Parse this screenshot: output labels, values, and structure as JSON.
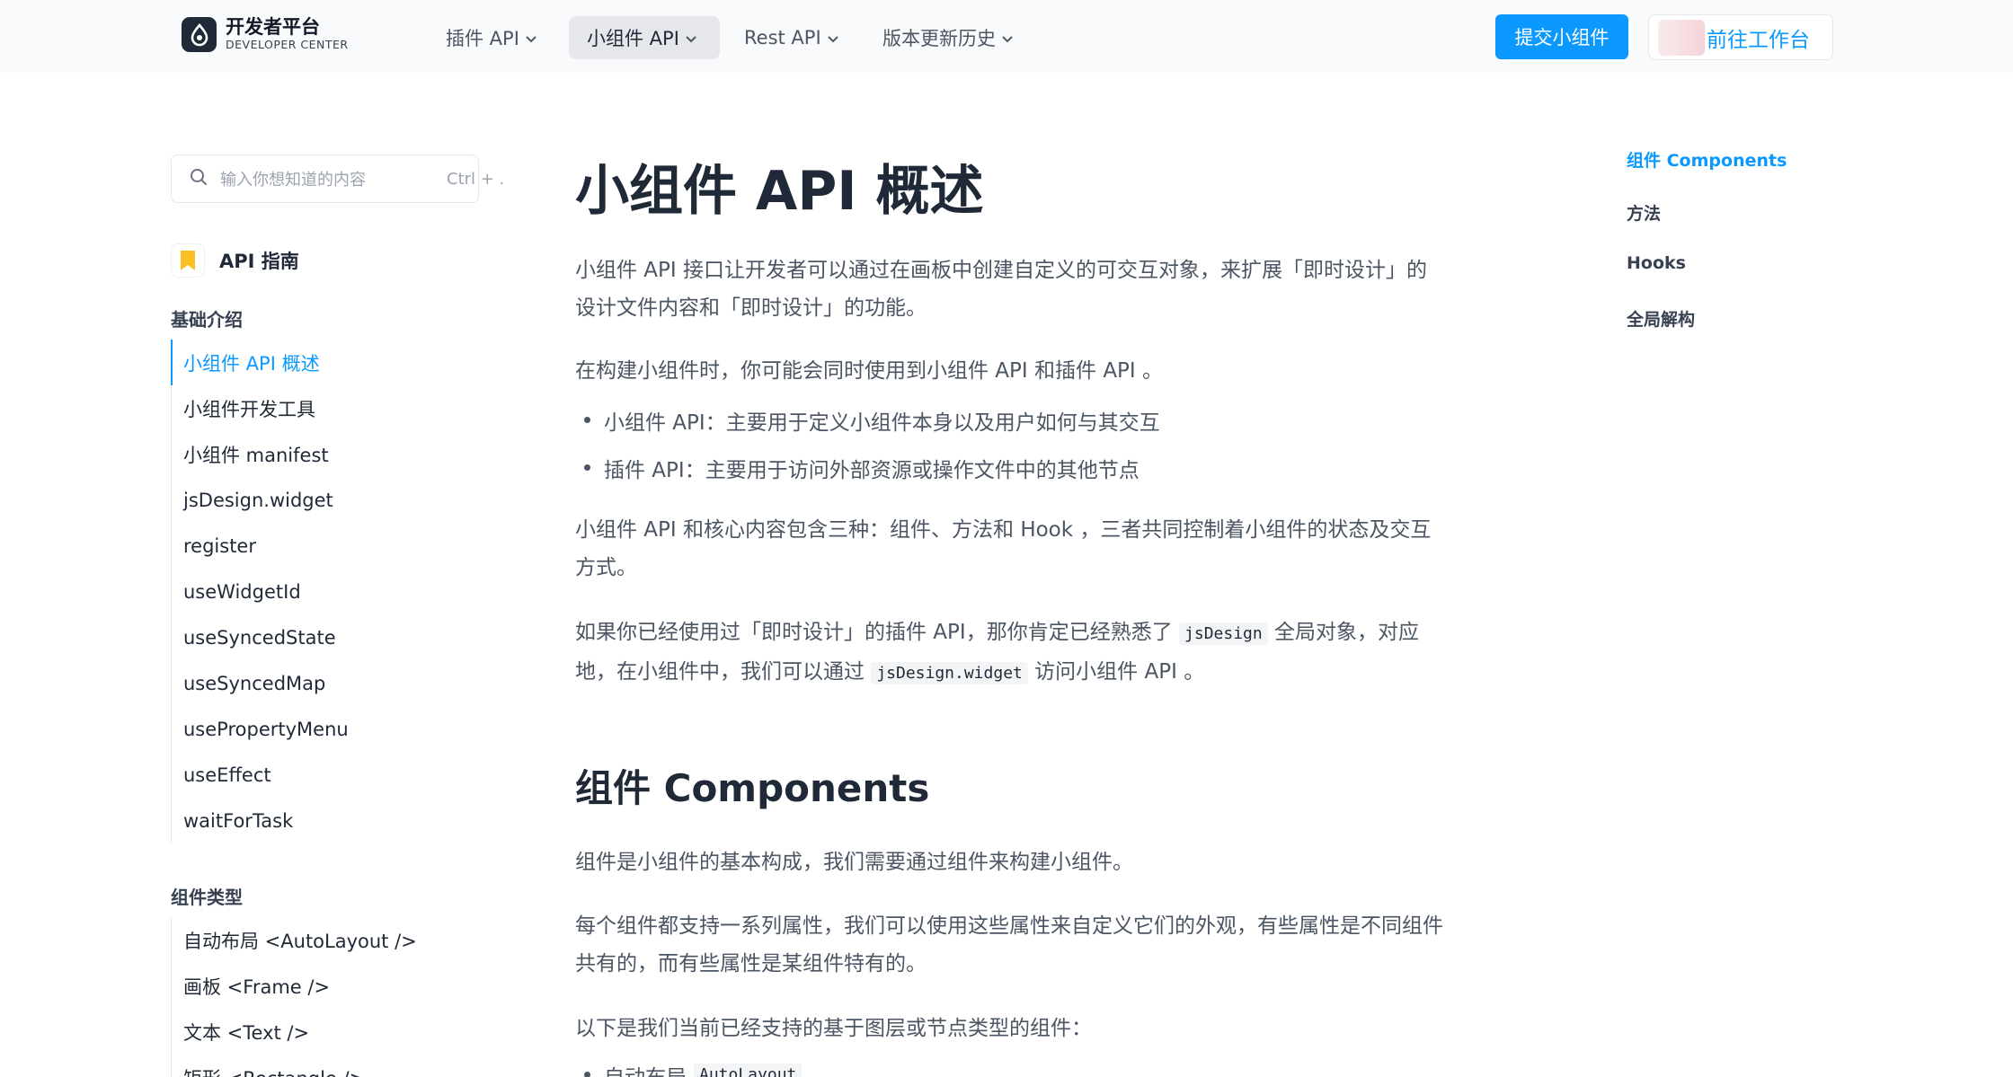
{
  "header": {
    "logo_title": "开发者平台",
    "logo_subtitle": "DEVELOPER CENTER",
    "nav": [
      {
        "label": "插件 API"
      },
      {
        "label": "小组件 API"
      },
      {
        "label": "Rest API"
      },
      {
        "label": "版本更新历史"
      }
    ],
    "submit_label": "提交小组件",
    "workspace_label": "前往工作台"
  },
  "sidebar": {
    "search_placeholder": "输入你想知道的内容",
    "search_shortcut": "Ctrl + .",
    "guide_label": "API 指南",
    "groups": [
      {
        "title": "基础介绍",
        "items": [
          "小组件 API 概述",
          "小组件开发工具",
          "小组件 manifest",
          "jsDesign.widget",
          "register",
          "useWidgetId",
          "useSyncedState",
          "useSyncedMap",
          "usePropertyMenu",
          "useEffect",
          "waitForTask"
        ]
      },
      {
        "title": "组件类型",
        "items": [
          "自动布局 <AutoLayout />",
          "画板 <Frame />",
          "文本 <Text />",
          "矩形 <Rectangle />"
        ]
      }
    ],
    "active_item": "小组件 API 概述"
  },
  "main": {
    "title": "小组件 API 概述",
    "intro": "小组件 API 接口让开发者可以通过在画板中创建自定义的可交互对象，来扩展「即时设计」的设计文件内容和「即时设计」的功能。",
    "p2": "在构建小组件时，你可能会同时使用到小组件 API 和插件 API 。",
    "bullets": [
      "小组件 API：主要用于定义小组件本身以及用户如何与其交互",
      "插件 API：主要用于访问外部资源或操作文件中的其他节点"
    ],
    "p3": "小组件 API 和核心内容包含三种：组件、方法和 Hook ，三者共同控制着小组件的状态及交互方式。",
    "p4_a": "如果你已经使用过「即时设计」的插件 API，那你肯定已经熟悉了 ",
    "p4_code1": "jsDesign",
    "p4_b": " 全局对象，对应地，在小组件中，我们可以通过 ",
    "p4_code2": "jsDesign.widget",
    "p4_c": " 访问小组件 API 。",
    "h2": "组件 Components",
    "p5": "组件是小组件的基本构成，我们需要通过组件来构建小组件。",
    "p6": "每个组件都支持一系列属性，我们可以使用这些属性来自定义它们的外观，有些属性是不同组件共有的，而有些属性是某组件特有的。",
    "p7": "以下是我们当前已经支持的基于图层或节点类型的组件：",
    "list2_first": "自动布局",
    "list2_first_code": "AutoLayout"
  },
  "toc": {
    "items": [
      "组件 Components",
      "方法",
      "Hooks",
      "全局解构"
    ],
    "active": "组件 Components"
  },
  "colors": {
    "accent": "#0b99ff",
    "text": "#1f2937",
    "muted": "#4b5563"
  }
}
